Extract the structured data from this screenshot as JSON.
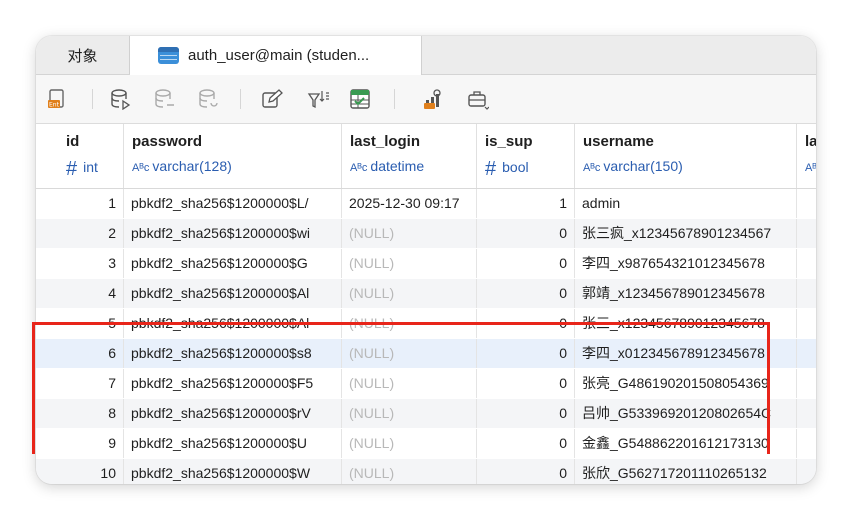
{
  "tabs": [
    {
      "label": "对象"
    },
    {
      "label": "auth_user@main (studen..."
    }
  ],
  "toolbar": {
    "icons": [
      "export-icon",
      "add-row-icon",
      "delete-row-icon",
      "refresh-icon",
      "edit-icon",
      "sort-icon",
      "grid-view-icon",
      "chart-icon",
      "tools-icon"
    ]
  },
  "columns": [
    {
      "name": "id",
      "type_prefix": "#",
      "type": "int"
    },
    {
      "name": "password",
      "type_prefix": "Aᴮᴄ",
      "type": "varchar(128)"
    },
    {
      "name": "last_login",
      "type_prefix": "Aᴮᴄ",
      "type": "datetime"
    },
    {
      "name": "is_sup",
      "type_prefix": "#",
      "type": "bool"
    },
    {
      "name": "username",
      "type_prefix": "Aᴮᴄ",
      "type": "varchar(150)"
    },
    {
      "name": "la",
      "type_prefix": "Aᴮ",
      "type": ""
    }
  ],
  "rows": [
    {
      "id": "1",
      "password": "pbkdf2_sha256$1200000$L/",
      "last_login": "2025-12-30 09:17",
      "is_sup": "1",
      "username": "admin"
    },
    {
      "id": "2",
      "password": "pbkdf2_sha256$1200000$wi",
      "last_login": "(NULL)",
      "is_sup": "0",
      "username": "张三疯_x12345678901234567"
    },
    {
      "id": "3",
      "password": "pbkdf2_sha256$1200000$G",
      "last_login": "(NULL)",
      "is_sup": "0",
      "username": "李四_x987654321012345678"
    },
    {
      "id": "4",
      "password": "pbkdf2_sha256$1200000$Al",
      "last_login": "(NULL)",
      "is_sup": "0",
      "username": "郭靖_x123456789012345678"
    },
    {
      "id": "5",
      "password": "pbkdf2_sha256$1200000$Al",
      "last_login": "(NULL)",
      "is_sup": "0",
      "username": "张三_x123456789012345678"
    },
    {
      "id": "6",
      "password": "pbkdf2_sha256$1200000$s8",
      "last_login": "(NULL)",
      "is_sup": "0",
      "username": "李四_x012345678912345678"
    },
    {
      "id": "7",
      "password": "pbkdf2_sha256$1200000$F5",
      "last_login": "(NULL)",
      "is_sup": "0",
      "username": "张亮_G486190201508054369"
    },
    {
      "id": "8",
      "password": "pbkdf2_sha256$1200000$rV",
      "last_login": "(NULL)",
      "is_sup": "0",
      "username": "吕帅_G53396920120802654C"
    },
    {
      "id": "9",
      "password": "pbkdf2_sha256$1200000$U",
      "last_login": "(NULL)",
      "is_sup": "0",
      "username": "金鑫_G548862201612173130"
    },
    {
      "id": "10",
      "password": "pbkdf2_sha256$1200000$W",
      "last_login": "(NULL)",
      "is_sup": "0",
      "username": "张欣_G562717201110265132"
    }
  ],
  "colors": {
    "accent": "#2a5db0",
    "highlight": "#e8251a",
    "null": "#b8b8b8"
  }
}
